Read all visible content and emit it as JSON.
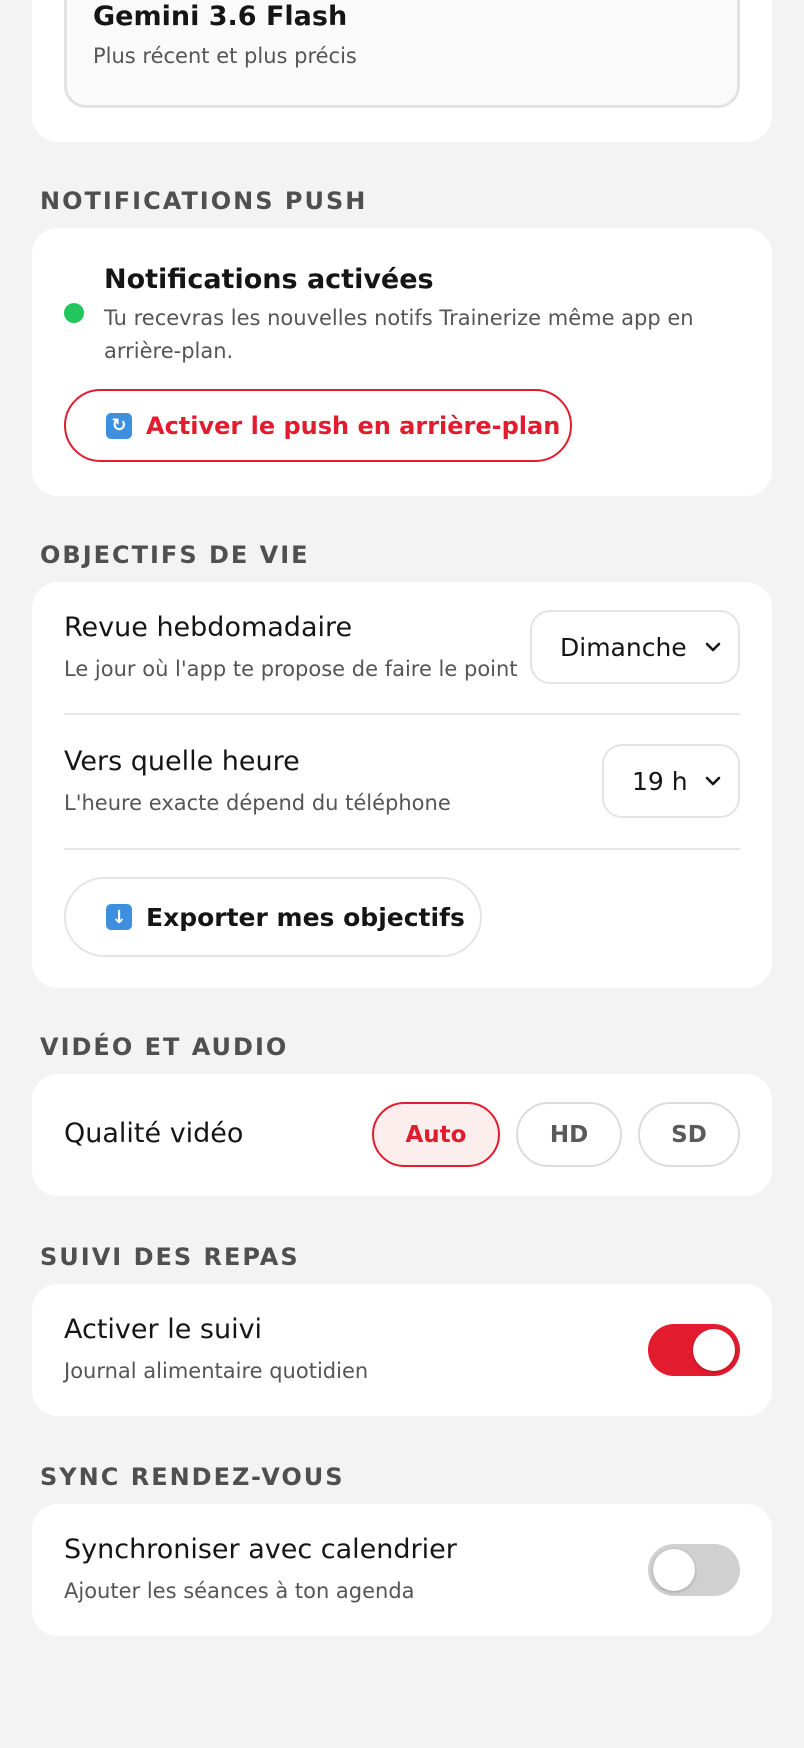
{
  "model": {
    "name": "Gemini 3.6 Flash",
    "description": "Plus récent et plus précis"
  },
  "push": {
    "section_title": "NOTIFICATIONS PUSH",
    "status_title": "Notifications activées",
    "status_desc": "Tu recevras les nouvelles notifs Trainerize même app en arrière-plan.",
    "status_color": "#22c55e",
    "button_label": "Activer le push en arrière-plan",
    "button_icon": "repeat-arrows-icon"
  },
  "goals": {
    "section_title": "OBJECTIFS DE VIE",
    "review_title": "Revue hebdomadaire",
    "review_desc": "Le jour où l'app te propose de faire le point",
    "review_value": "Dimanche",
    "time_title": "Vers quelle heure",
    "time_desc": "L'heure exacte dépend du téléphone",
    "time_value": "19 h",
    "export_label": "Exporter mes objectifs",
    "export_icon": "down-arrow-icon"
  },
  "video": {
    "section_title": "VIDÉO ET AUDIO",
    "quality_label": "Qualité vidéo",
    "options": [
      "Auto",
      "HD",
      "SD"
    ],
    "selected": "Auto"
  },
  "meals": {
    "section_title": "SUIVI DES REPAS",
    "title": "Activer le suivi",
    "desc": "Journal alimentaire quotidien",
    "enabled": true
  },
  "sync": {
    "section_title": "SYNC RENDEZ-VOUS",
    "title": "Synchroniser avec calendrier",
    "desc": "Ajouter les séances à ton agenda",
    "enabled": false
  },
  "colors": {
    "accent": "#e31b2e",
    "toggle_off": "#d0d0d0",
    "background": "#f3f3f3"
  }
}
